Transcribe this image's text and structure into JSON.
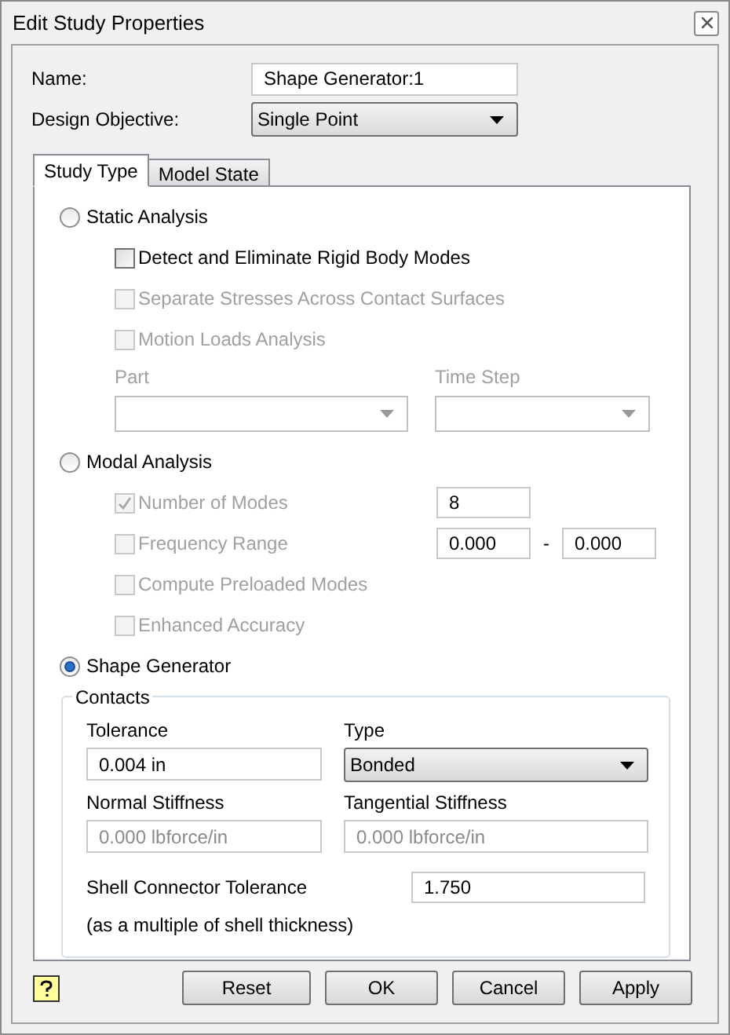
{
  "window": {
    "title": "Edit Study Properties"
  },
  "name_field": {
    "label": "Name:",
    "value": "Shape Generator:1"
  },
  "design_objective": {
    "label": "Design Objective:",
    "value": "Single Point"
  },
  "tabs": [
    {
      "label": "Study Type",
      "selected": true
    },
    {
      "label": "Model State",
      "selected": false
    }
  ],
  "study_types": [
    {
      "label": "Static Analysis",
      "selected": false,
      "options": [
        {
          "kind": "checkbox",
          "label": "Detect and Eliminate Rigid Body Modes",
          "checked": false,
          "disabled": false
        },
        {
          "kind": "checkbox",
          "label": "Separate Stresses Across Contact Surfaces",
          "checked": false,
          "disabled": true
        },
        {
          "kind": "checkbox",
          "label": "Motion Loads Analysis",
          "checked": false,
          "disabled": true
        },
        {
          "kind": "dropdowns",
          "labels": [
            "Part",
            "Time Step"
          ],
          "disabled": true
        }
      ]
    },
    {
      "label": "Modal Analysis",
      "selected": false,
      "options": [
        {
          "kind": "checkbox",
          "label": "Number of Modes",
          "checked": true,
          "disabled": true,
          "values": [
            "8"
          ]
        },
        {
          "kind": "checkbox",
          "label": "Frequency Range",
          "checked": false,
          "disabled": true,
          "values": [
            "0.000",
            "0.000"
          ],
          "separator": "-"
        },
        {
          "kind": "checkbox",
          "label": "Compute Preloaded Modes",
          "checked": false,
          "disabled": true
        },
        {
          "kind": "checkbox",
          "label": "Enhanced Accuracy",
          "checked": false,
          "disabled": true
        }
      ]
    },
    {
      "label": "Shape Generator",
      "selected": true
    }
  ],
  "contacts": {
    "title": "Contacts",
    "tolerance": {
      "label": "Tolerance",
      "value": "0.004 in"
    },
    "type": {
      "label": "Type",
      "value": "Bonded"
    },
    "normal_stiffness": {
      "label": "Normal Stiffness",
      "value": "0.000 lbforce/in",
      "disabled": true
    },
    "tangential_stiffness": {
      "label": "Tangential Stiffness",
      "value": "0.000 lbforce/in",
      "disabled": true
    },
    "shell_connector_tolerance": {
      "label": "Shell Connector Tolerance",
      "note": "(as a multiple of shell thickness)",
      "value": "1.750"
    }
  },
  "buttons": [
    "Reset",
    "OK",
    "Cancel",
    "Apply"
  ]
}
